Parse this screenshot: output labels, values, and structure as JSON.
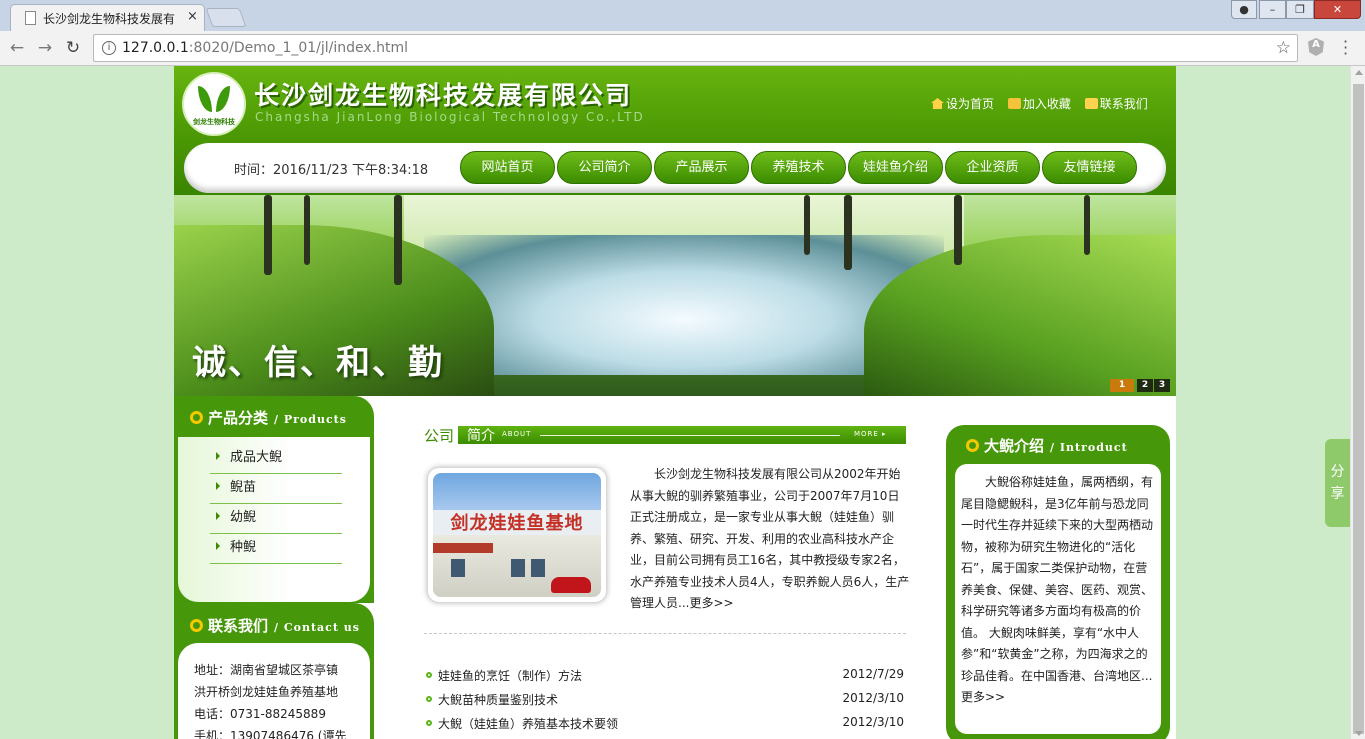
{
  "browser": {
    "tab_title": "长沙剑龙生物科技发展有",
    "tab_close": "×",
    "url_host": "127.0.0.1",
    "url_path": ":8020/Demo_1_01/jl/index.html"
  },
  "header": {
    "logo_text": "剑龙生物科技",
    "company_cn": "长沙剑龙生物科技发展有限公司",
    "company_en": "Changsha JianLong Biological Technology Co.,LTD",
    "links": [
      "设为首页",
      "加入收藏",
      "联系我们"
    ]
  },
  "nav": {
    "clock": "时间：2016/11/23 下午8:34:18",
    "items": [
      "网站首页",
      "公司简介",
      "产品展示",
      "养殖技术",
      "娃娃鱼介绍",
      "企业资质",
      "友情链接"
    ]
  },
  "banner": {
    "slogan": "诚、信、和、勤",
    "pager": [
      "1",
      "2",
      "3"
    ]
  },
  "products": {
    "title": "产品分类",
    "title_en": "/ Products",
    "items": [
      "成品大鲵",
      "鲵苗",
      "幼鲵",
      "种鲵"
    ]
  },
  "contact": {
    "title": "联系我们",
    "title_en": "/ Contact us",
    "lines": [
      "地址：湖南省望城区茶亭镇",
      "洪开桥剑龙娃娃鱼养殖基地",
      "电话：0731-88245889",
      "手机：13907486476 (谭先"
    ]
  },
  "about": {
    "title_a": "公司",
    "title_b": "简介",
    "about_label": "ABOUT",
    "more_label": "MORE ▸",
    "photo_sign": "剑龙娃娃鱼基地",
    "text": "长沙剑龙生物科技发展有限公司从2002年开始从事大鲵的驯养繁殖事业，公司于2007年7月10日正式注册成立，是一家专业从事大鲵（娃娃鱼）驯养、繁殖、研究、开发、利用的农业高科技水产企业，目前公司拥有员工16名，其中教授级专家2名，水产养殖专业技术人员4人，专职养鲵人员6人，生产管理人员...更多>>"
  },
  "news": [
    {
      "title": "娃娃鱼的烹饪（制作）方法",
      "date": "2012/7/29"
    },
    {
      "title": "大鲵苗种质量鉴别技术",
      "date": "2012/3/10"
    },
    {
      "title": "大鲵（娃娃鱼）养殖基本技术要领",
      "date": "2012/3/10"
    }
  ],
  "intro_box": {
    "title": "大鲵介绍",
    "title_en": "/ Introduct",
    "text": "大鲵俗称娃娃鱼，属两栖纲，有尾目隐鳃鲵科，是3亿年前与恐龙同一时代生存并延续下来的大型两栖动物，被称为研究生物进化的“活化石”，属于国家二类保护动物，在营养美食、保健、美容、医药、观赏、科学研究等诸多方面均有极高的价值。 大鲵肉味鲜美，享有“水中人参”和“软黄金”之称，为四海求之的珍品佳肴。在中国香港、台湾地区...更多>>"
  },
  "share": {
    "label_1": "分",
    "label_2": "享"
  },
  "colors": {
    "brand_green": "#46970a",
    "page_bg": "#cdebc9",
    "accent_yellow": "#f5c800"
  }
}
